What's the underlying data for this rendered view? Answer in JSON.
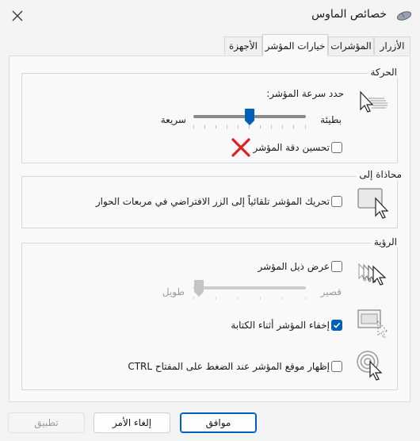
{
  "window": {
    "title": "خصائص الماوس"
  },
  "tabs": [
    {
      "label": "الأزرار"
    },
    {
      "label": "المؤشرات"
    },
    {
      "label": "خيارات المؤشر"
    },
    {
      "label": "الأجهزة"
    }
  ],
  "motion": {
    "legend": "الحركة",
    "speed_label": "حدد سرعة المؤشر:",
    "slow_label": "بطيئة",
    "fast_label": "سريعة",
    "speed_value_fraction": 0.5,
    "precision_label": "تحسين دقة المؤشر",
    "precision_checked": false
  },
  "snap_to": {
    "legend": "محاذاة إلى",
    "label": "تحريك المؤشر تلقائياً إلى الزر الافتراضي في مربعات الحوار",
    "checked": false
  },
  "visibility": {
    "legend": "الرؤية",
    "trails_label": "عرض ذيل المؤشر",
    "trails_checked": false,
    "short_label": "قصير",
    "long_label": "طويل",
    "trails_length_fraction": 0.0,
    "hide_typing_label": "إخفاء المؤشر أثناء الكتابة",
    "hide_typing_checked": true,
    "show_location_label": "إظهار موقع المؤشر عند الضغط على المفتاح CTRL",
    "show_location_checked": false
  },
  "buttons": {
    "ok": "موافق",
    "cancel": "إلغاء الأمر",
    "apply": "تطبيق"
  },
  "colors": {
    "accent": "#005fb8",
    "annotation_x": "#e02020"
  }
}
